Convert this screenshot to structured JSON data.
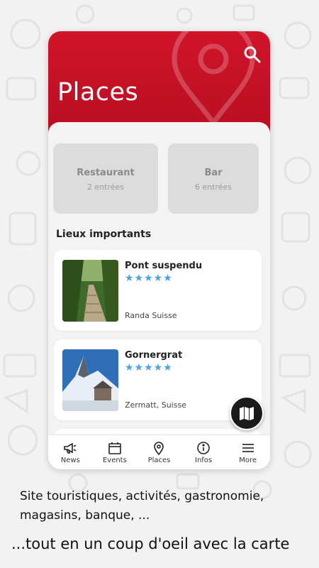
{
  "header": {
    "title": "Places"
  },
  "categories": [
    {
      "name": "Restaurant",
      "count": "2 entrées"
    },
    {
      "name": "Bar",
      "count": "6 entrées"
    }
  ],
  "section": {
    "title": "Lieux importants"
  },
  "places": [
    {
      "title": "Pont suspendu",
      "rating": 5,
      "stars": "★★★★★",
      "location": "Randa Suisse"
    },
    {
      "title": "Gornergrat",
      "rating": 5,
      "stars": "★★★★★",
      "location": "Zermatt, Suisse"
    }
  ],
  "tabs": [
    {
      "label": "News",
      "icon": "megaphone-icon"
    },
    {
      "label": "Events",
      "icon": "calendar-icon"
    },
    {
      "label": "Places",
      "icon": "location-pin-icon"
    },
    {
      "label": "Infos",
      "icon": "info-icon"
    },
    {
      "label": "More",
      "icon": "menu-icon"
    }
  ],
  "captions": {
    "line1": "Site touristiques, activités, gastronomie, magasins, banque, ...",
    "line2": "...tout en un coup d'oeil avec la carte"
  },
  "colors": {
    "brand_red": "#c8102e",
    "star_blue": "#4aa3e0"
  }
}
